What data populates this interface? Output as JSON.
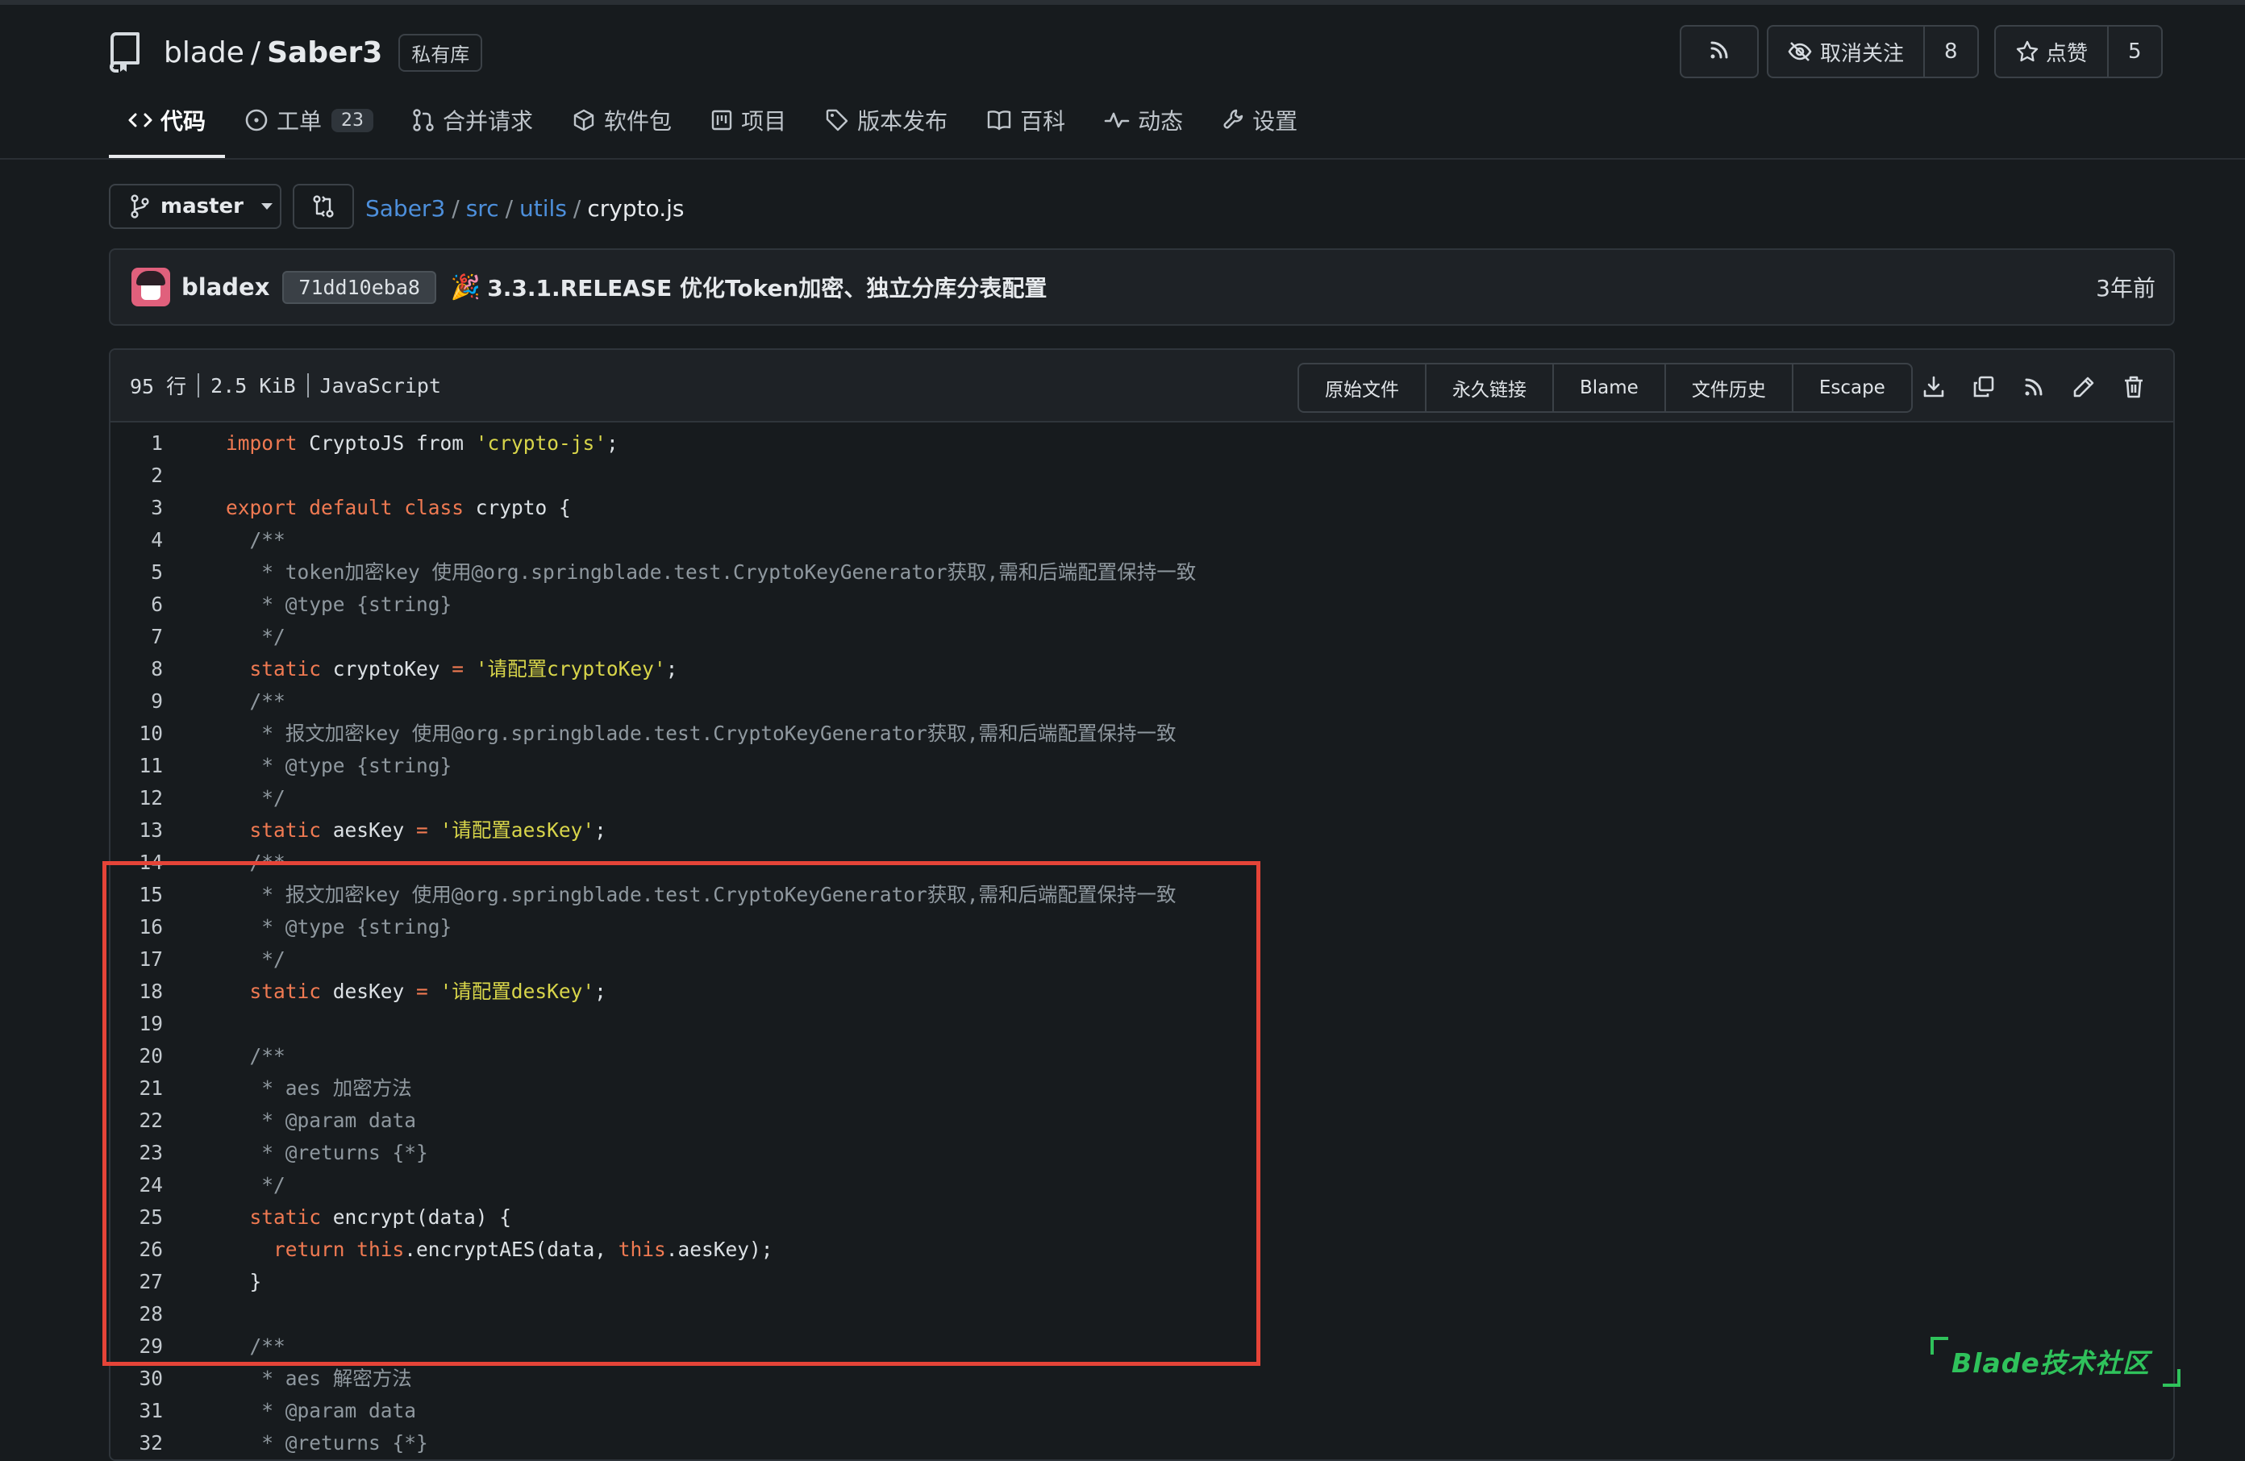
{
  "repo": {
    "owner": "blade",
    "separator": "/",
    "name": "Saber3",
    "visibility_badge": "私有库"
  },
  "header_actions": {
    "unwatch_label": "取消关注",
    "watch_count": "8",
    "star_label": "点赞",
    "star_count": "5"
  },
  "tabs": [
    {
      "label": "代码",
      "icon": "code-icon",
      "active": true
    },
    {
      "label": "工单",
      "icon": "issue-icon",
      "count": "23"
    },
    {
      "label": "合并请求",
      "icon": "pull-request-icon"
    },
    {
      "label": "软件包",
      "icon": "package-icon"
    },
    {
      "label": "项目",
      "icon": "project-icon"
    },
    {
      "label": "版本发布",
      "icon": "tag-icon"
    },
    {
      "label": "百科",
      "icon": "book-icon"
    },
    {
      "label": "动态",
      "icon": "pulse-icon"
    },
    {
      "label": "设置",
      "icon": "tool-icon"
    }
  ],
  "branch": {
    "name": "master"
  },
  "breadcrumb": {
    "parts": [
      "Saber3",
      "src",
      "utils"
    ],
    "separator": "/",
    "current": "crypto.js"
  },
  "commit": {
    "author": "bladex",
    "sha": "71dd10eba8",
    "emoji": "🎉",
    "message": "3.3.1.RELEASE 优化Token加密、独立分库分表配置",
    "time": "3年前"
  },
  "file": {
    "lines": "95 行",
    "size": "2.5 KiB",
    "language": "JavaScript",
    "buttons": [
      "原始文件",
      "永久链接",
      "Blame",
      "文件历史",
      "Escape"
    ],
    "icons": [
      "download-icon",
      "copy-icon",
      "rss-icon",
      "edit-icon",
      "trash-icon"
    ]
  },
  "code": [
    {
      "n": "1",
      "t": [
        [
          "kw",
          "import"
        ],
        [
          "p",
          " CryptoJS from "
        ],
        [
          "str",
          "'crypto-js'"
        ],
        [
          "p",
          ";"
        ]
      ]
    },
    {
      "n": "2",
      "t": []
    },
    {
      "n": "3",
      "t": [
        [
          "kw",
          "export default class"
        ],
        [
          "p",
          " crypto {"
        ]
      ]
    },
    {
      "n": "4",
      "t": [
        [
          "cm",
          "  /**"
        ]
      ]
    },
    {
      "n": "5",
      "t": [
        [
          "cm",
          "   * token加密key 使用@org.springblade.test.CryptoKeyGenerator获取,需和后端配置保持一致"
        ]
      ]
    },
    {
      "n": "6",
      "t": [
        [
          "cm",
          "   * @type {string}"
        ]
      ]
    },
    {
      "n": "7",
      "t": [
        [
          "cm",
          "   */"
        ]
      ]
    },
    {
      "n": "8",
      "t": [
        [
          "kw",
          "  static"
        ],
        [
          "p",
          " cryptoKey "
        ],
        [
          "kw",
          "="
        ],
        [
          "p",
          " "
        ],
        [
          "str",
          "'请配置cryptoKey'"
        ],
        [
          "p",
          ";"
        ]
      ]
    },
    {
      "n": "9",
      "t": [
        [
          "cm",
          "  /**"
        ]
      ]
    },
    {
      "n": "10",
      "t": [
        [
          "cm",
          "   * 报文加密key 使用@org.springblade.test.CryptoKeyGenerator获取,需和后端配置保持一致"
        ]
      ]
    },
    {
      "n": "11",
      "t": [
        [
          "cm",
          "   * @type {string}"
        ]
      ]
    },
    {
      "n": "12",
      "t": [
        [
          "cm",
          "   */"
        ]
      ]
    },
    {
      "n": "13",
      "t": [
        [
          "kw",
          "  static"
        ],
        [
          "p",
          " aesKey "
        ],
        [
          "kw",
          "="
        ],
        [
          "p",
          " "
        ],
        [
          "str",
          "'请配置aesKey'"
        ],
        [
          "p",
          ";"
        ]
      ]
    },
    {
      "n": "14",
      "t": [
        [
          "cm",
          "  /**"
        ]
      ]
    },
    {
      "n": "15",
      "t": [
        [
          "cm",
          "   * 报文加密key 使用@org.springblade.test.CryptoKeyGenerator获取,需和后端配置保持一致"
        ]
      ]
    },
    {
      "n": "16",
      "t": [
        [
          "cm",
          "   * @type {string}"
        ]
      ]
    },
    {
      "n": "17",
      "t": [
        [
          "cm",
          "   */"
        ]
      ]
    },
    {
      "n": "18",
      "t": [
        [
          "kw",
          "  static"
        ],
        [
          "p",
          " desKey "
        ],
        [
          "kw",
          "="
        ],
        [
          "p",
          " "
        ],
        [
          "str",
          "'请配置desKey'"
        ],
        [
          "p",
          ";"
        ]
      ]
    },
    {
      "n": "19",
      "t": []
    },
    {
      "n": "20",
      "t": [
        [
          "cm",
          "  /**"
        ]
      ]
    },
    {
      "n": "21",
      "t": [
        [
          "cm",
          "   * aes 加密方法"
        ]
      ]
    },
    {
      "n": "22",
      "t": [
        [
          "cm",
          "   * @param data"
        ]
      ]
    },
    {
      "n": "23",
      "t": [
        [
          "cm",
          "   * @returns {*}"
        ]
      ]
    },
    {
      "n": "24",
      "t": [
        [
          "cm",
          "   */"
        ]
      ]
    },
    {
      "n": "25",
      "t": [
        [
          "kw",
          "  static"
        ],
        [
          "p",
          " encrypt(data) {"
        ]
      ]
    },
    {
      "n": "26",
      "t": [
        [
          "kw",
          "    return this"
        ],
        [
          "p",
          ".encryptAES(data, "
        ],
        [
          "kw",
          "this"
        ],
        [
          "p",
          ".aesKey);"
        ]
      ]
    },
    {
      "n": "27",
      "t": [
        [
          "p",
          "  }"
        ]
      ]
    },
    {
      "n": "28",
      "t": []
    },
    {
      "n": "29",
      "t": [
        [
          "cm",
          "  /**"
        ]
      ]
    },
    {
      "n": "30",
      "t": [
        [
          "cm",
          "   * aes 解密方法"
        ]
      ]
    },
    {
      "n": "31",
      "t": [
        [
          "cm",
          "   * @param data"
        ]
      ]
    },
    {
      "n": "32",
      "t": [
        [
          "cm",
          "   * @returns {*}"
        ]
      ]
    }
  ],
  "watermark": "Blade技术社区",
  "colors": {
    "background": "#171b1e",
    "keyword": "#f07a52",
    "string": "#d8d54a",
    "comment": "#8f989f",
    "link": "#4d8fdb",
    "highlight_box": "#e54438",
    "watermark": "#2fc25b"
  }
}
